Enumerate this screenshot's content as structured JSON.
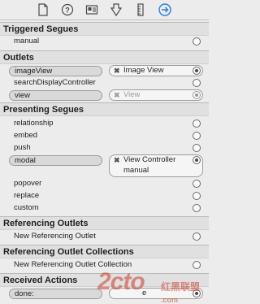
{
  "sections": {
    "triggered": "Triggered Segues",
    "outlets": "Outlets",
    "presenting": "Presenting Segues",
    "ref_outlets": "Referencing Outlets",
    "ref_collections": "Referencing Outlet Collections",
    "received": "Received Actions"
  },
  "triggered": {
    "manual": "manual"
  },
  "outlets": {
    "imageView": "imageView",
    "imageView_target": "Image View",
    "searchDisplayController": "searchDisplayController",
    "view": "view",
    "view_target": "View"
  },
  "presenting": {
    "relationship": "relationship",
    "embed": "embed",
    "push": "push",
    "modal": "modal",
    "modal_target": "View Controller",
    "modal_target_sub": "manual",
    "popover": "popover",
    "replace": "replace",
    "custom": "custom"
  },
  "ref_outlets": {
    "new": "New Referencing Outlet"
  },
  "ref_collections": {
    "new": "New Referencing Outlet Collection"
  },
  "received": {
    "done": "done:",
    "done_target": "e"
  },
  "watermark": {
    "main": "2cto",
    "com": ".com",
    "cn": "红黑联盟"
  },
  "colors": {
    "accent": "#2a7be4"
  }
}
